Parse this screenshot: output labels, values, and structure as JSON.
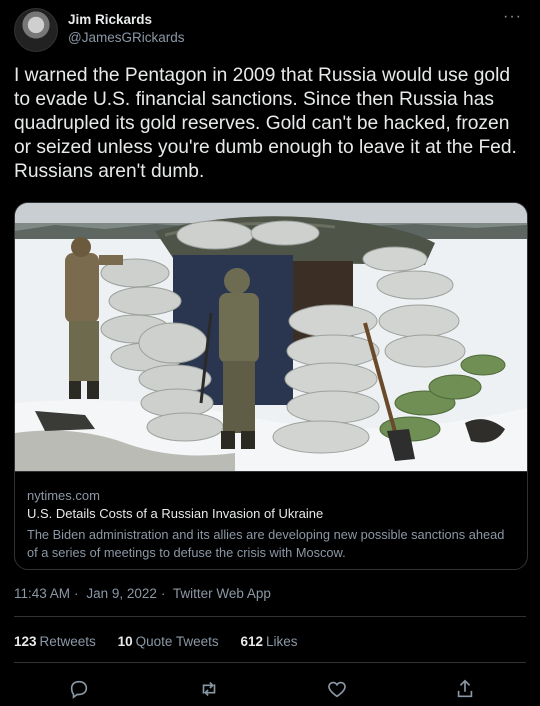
{
  "author": {
    "name": "Jim Rickards",
    "handle": "@JamesGRickards"
  },
  "tweet": {
    "text": "I warned the Pentagon in 2009 that Russia would use gold to evade U.S. financial sanctions. Since then Russia has quadrupled its gold reserves. Gold can't be hacked, frozen or seized unless you're dumb enough to leave it at the Fed. Russians aren't dumb."
  },
  "card": {
    "domain": "nytimes.com",
    "title": "U.S. Details Costs of a Russian Invasion of Ukraine",
    "description": "The Biden administration and its allies are developing new possible sanctions ahead of a series of meetings to defuse the crisis with Moscow."
  },
  "meta": {
    "time": "11:43 AM",
    "date": "Jan 9, 2022",
    "source": "Twitter Web App",
    "separator": "·"
  },
  "stats": {
    "retweets_count": "123",
    "retweets_label": "Retweets",
    "quotes_count": "10",
    "quotes_label": "Quote Tweets",
    "likes_count": "612",
    "likes_label": "Likes"
  },
  "more_glyph": "···",
  "colors": {
    "background": "#000000",
    "text": "#e7e9ea",
    "secondary": "#8b98a5",
    "border": "#2f3336"
  },
  "icons": [
    "more-icon",
    "reply-icon",
    "retweet-icon",
    "like-icon",
    "share-icon"
  ]
}
